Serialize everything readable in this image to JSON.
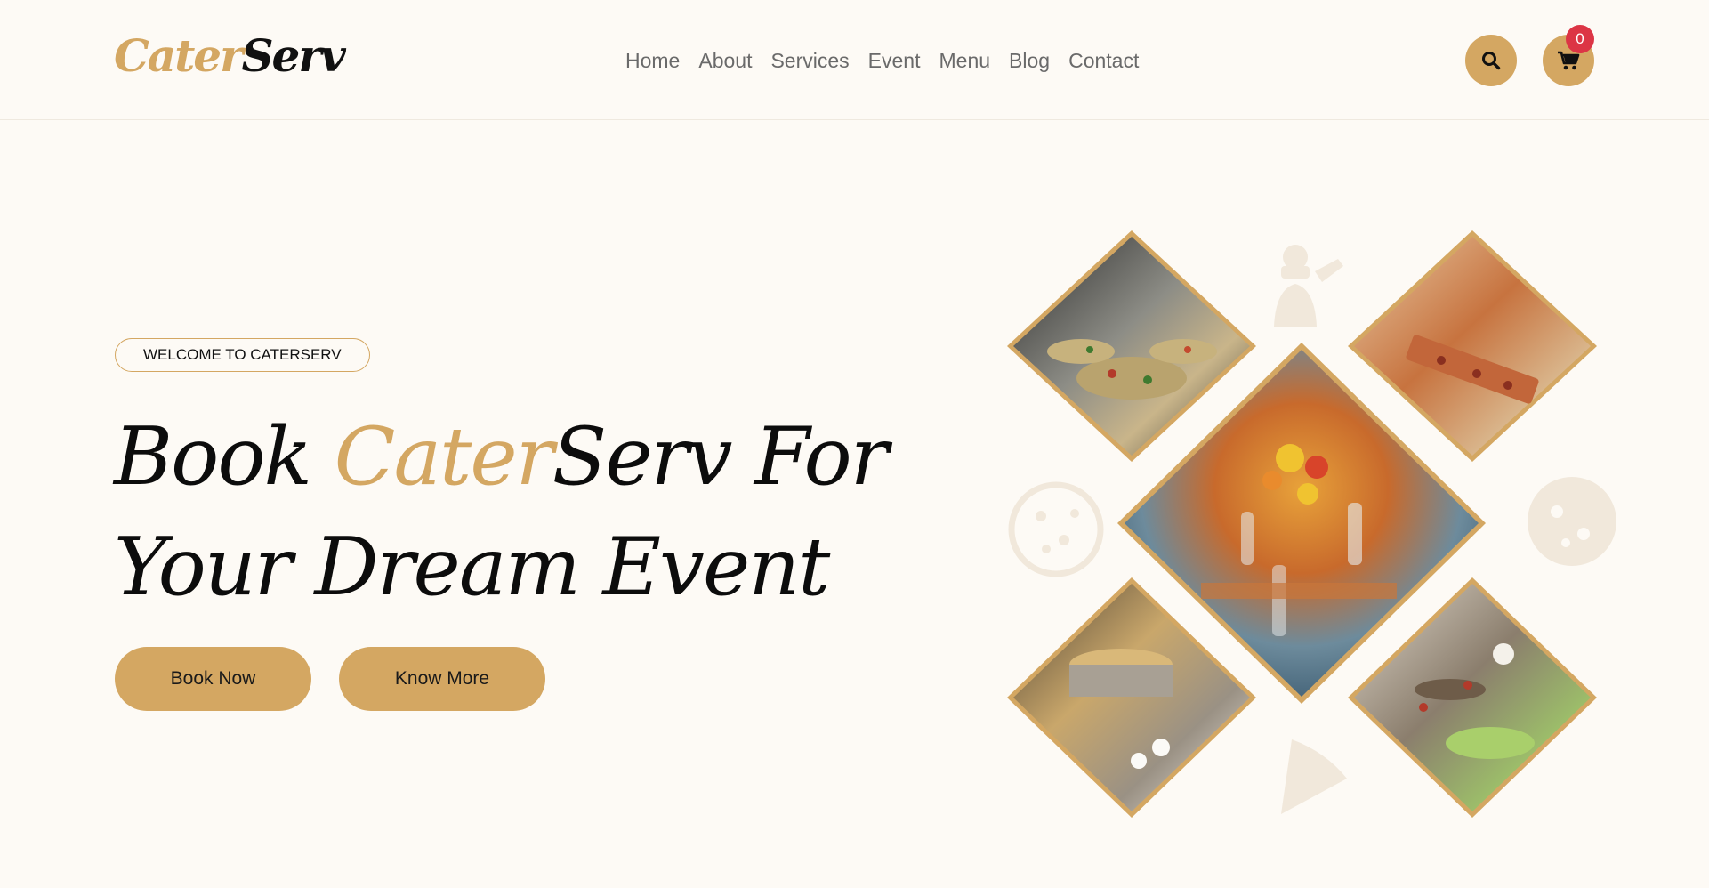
{
  "brand": {
    "logo_part1": "Cater",
    "logo_part2": "Serv"
  },
  "nav": {
    "items": [
      "Home",
      "About",
      "Services",
      "Event",
      "Menu",
      "Blog",
      "Contact"
    ]
  },
  "header_actions": {
    "search_icon": "search-icon",
    "cart_icon": "cart-icon",
    "cart_count": "0"
  },
  "hero": {
    "badge": "WELCOME TO CATERSERV",
    "headline_part1": "Book ",
    "headline_highlight": "Cater",
    "headline_part2": "Serv For",
    "headline_line2": "Your Dream Event",
    "book_button": "Book Now",
    "more_button": "Know More"
  },
  "gallery": {
    "images": [
      "salad-buffet-photo",
      "canape-tray-photo",
      "table-flowers-photo",
      "chafing-dish-buffet-photo",
      "appetizer-platter-photo"
    ],
    "decorations": [
      "chef-icon",
      "pizza-icon",
      "pizza-icon",
      "pizza-slice-icon"
    ]
  },
  "colors": {
    "accent": "#d4a762",
    "badge_red": "#dc3545",
    "background": "#fdfaf5",
    "text_dark": "#0c0c0c",
    "nav_text": "#6a6a6a"
  }
}
